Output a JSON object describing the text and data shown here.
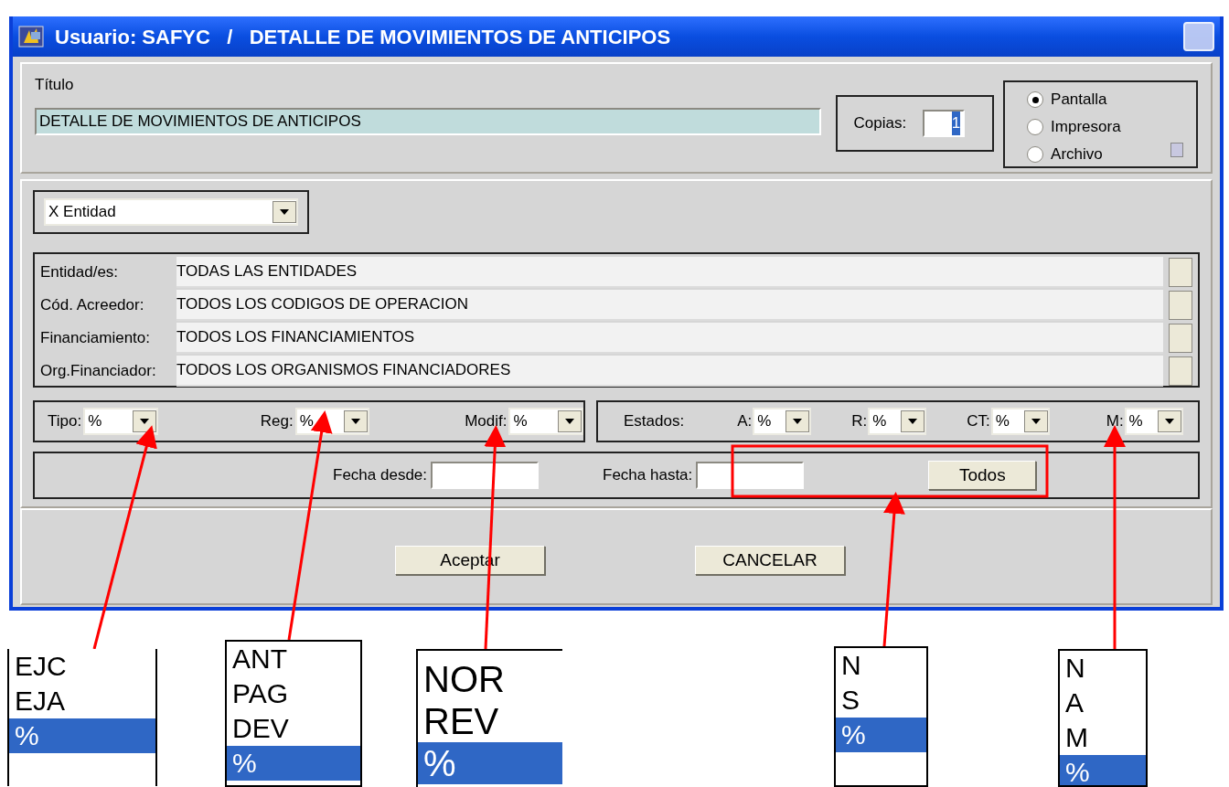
{
  "window": {
    "title": "Usuario: SAFYC   /   DETALLE DE MOVIMIENTOS DE ANTICIPOS"
  },
  "titulo": {
    "label": "Título",
    "value": "DETALLE DE MOVIMIENTOS DE ANTICIPOS"
  },
  "copias": {
    "label": "Copias:",
    "value": "1"
  },
  "output": [
    {
      "label": "Pantalla",
      "selected": true
    },
    {
      "label": "Impresora",
      "selected": false
    },
    {
      "label": "Archivo",
      "selected": false
    }
  ],
  "group_by": {
    "value": "X Entidad"
  },
  "filters": [
    {
      "label": "Entidad/es:",
      "value": "TODAS LAS ENTIDADES"
    },
    {
      "label": "Cód. Acreedor:",
      "value": "TODOS LOS CODIGOS DE OPERACION"
    },
    {
      "label": "Financiamiento:",
      "value": "TODOS LOS FINANCIAMIENTOS"
    },
    {
      "label": "Org.Financiador:",
      "value": "TODOS LOS ORGANISMOS FINANCIADORES"
    }
  ],
  "selectors": [
    {
      "label": "Tipo:",
      "value": "%"
    },
    {
      "label": "Reg:",
      "value": "%"
    },
    {
      "label": "Modif:",
      "value": "%"
    }
  ],
  "estados": {
    "label": "Estados:",
    "selectors": [
      {
        "label": "A:",
        "value": "%"
      },
      {
        "label": "R:",
        "value": "%"
      },
      {
        "label": "CT:",
        "value": "%"
      },
      {
        "label": "M:",
        "value": "%"
      }
    ]
  },
  "dates": [
    {
      "label": "Fecha desde:"
    },
    {
      "label": "Fecha hasta:"
    }
  ],
  "todos_button": "Todos",
  "buttons": [
    "Aceptar",
    "CANCELAR"
  ],
  "callouts": [
    {
      "options": [
        {
          "label": "EJC",
          "selected": false
        },
        {
          "label": "EJA",
          "selected": false
        },
        {
          "label": "%",
          "selected": true
        }
      ]
    },
    {
      "options": [
        {
          "label": "ANT",
          "selected": false
        },
        {
          "label": "PAG",
          "selected": false
        },
        {
          "label": "DEV",
          "selected": false
        },
        {
          "label": "%",
          "selected": true
        }
      ]
    },
    {
      "options": [
        {
          "label": "NOR",
          "selected": false
        },
        {
          "label": "REV",
          "selected": false
        },
        {
          "label": "%",
          "selected": true
        }
      ]
    },
    {
      "options": [
        {
          "label": "N",
          "selected": false
        },
        {
          "label": "S",
          "selected": false
        },
        {
          "label": "%",
          "selected": true
        }
      ]
    },
    {
      "options": [
        {
          "label": "N",
          "selected": false
        },
        {
          "label": "A",
          "selected": false
        },
        {
          "label": "M",
          "selected": false
        },
        {
          "label": "%",
          "selected": true
        }
      ]
    }
  ]
}
